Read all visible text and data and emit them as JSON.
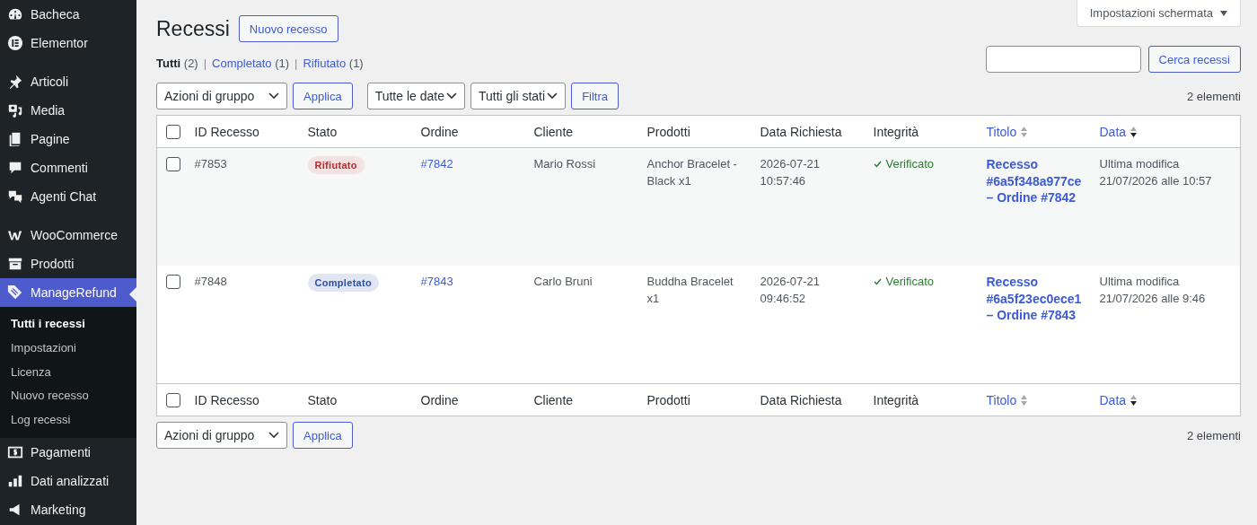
{
  "sidebar": {
    "groups": [
      {
        "items": [
          {
            "label": "Bacheca",
            "selected": false
          },
          {
            "label": "Elementor",
            "selected": false
          }
        ]
      },
      {
        "items": [
          {
            "label": "Articoli",
            "selected": false
          },
          {
            "label": "Media",
            "selected": false
          },
          {
            "label": "Pagine",
            "selected": false
          },
          {
            "label": "Commenti",
            "selected": false
          },
          {
            "label": "Agenti Chat",
            "selected": false
          }
        ]
      },
      {
        "items": [
          {
            "label": "WooCommerce",
            "selected": false
          },
          {
            "label": "Prodotti",
            "selected": false
          },
          {
            "label": "ManageRefund",
            "selected": true,
            "children": [
              {
                "label": "Tutti i recessi",
                "selected": true
              },
              {
                "label": "Impostazioni",
                "selected": false
              },
              {
                "label": "Licenza",
                "selected": false
              },
              {
                "label": "Nuovo recesso",
                "selected": false
              },
              {
                "label": "Log recessi",
                "selected": false
              }
            ]
          },
          {
            "label": "Pagamenti",
            "selected": false
          },
          {
            "label": "Dati analizzati",
            "selected": false
          },
          {
            "label": "Marketing",
            "selected": false
          }
        ]
      }
    ]
  },
  "screen_options": "Impostazioni schermata",
  "page_title": "Recessi",
  "add_new_button": "Nuovo recesso",
  "views": [
    {
      "label": "Tutti",
      "count": "(2)",
      "selected": true
    },
    {
      "separator_before": "|",
      "label": "Completato",
      "count": "(1)",
      "selected": false
    },
    {
      "separator_before": "|",
      "label": "Rifiutato",
      "count": "(1)",
      "selected": false
    }
  ],
  "search": {
    "button": "Cerca recessi"
  },
  "top_nav": {
    "bulk_action": "Azioni di gruppo",
    "apply": "Applica",
    "date_filter": "Tutte le date",
    "status_filter": "Tutti gli stati",
    "filter_button": "Filtra",
    "count": "2 elementi"
  },
  "table": {
    "columns": [
      {
        "label": "ID Recesso",
        "kind": "plain"
      },
      {
        "label": "Stato",
        "kind": "plain"
      },
      {
        "label": "Ordine",
        "kind": "plain"
      },
      {
        "label": "Cliente",
        "kind": "plain"
      },
      {
        "label": "Prodotti",
        "kind": "plain"
      },
      {
        "label": "Data Richiesta",
        "kind": "plain"
      },
      {
        "label": "Integrità",
        "kind": "plain"
      },
      {
        "label": "Titolo",
        "kind": "sortable",
        "sorted": false
      },
      {
        "label": "Data",
        "kind": "sortable",
        "sorted": true
      }
    ],
    "footer_columns": [
      {
        "label": "ID Recesso",
        "kind": "plain"
      },
      {
        "label": "Stato",
        "kind": "plain"
      },
      {
        "label": "Ordine",
        "kind": "plain"
      },
      {
        "label": "Cliente",
        "kind": "plain"
      },
      {
        "label": "Prodotti",
        "kind": "plain"
      },
      {
        "label": "Data Richiesta",
        "kind": "plain"
      },
      {
        "label": "Integrità",
        "kind": "plain"
      },
      {
        "label": "Titolo",
        "kind": "sortable",
        "sorted": false
      },
      {
        "label": "Data",
        "kind": "sortable",
        "sorted": true
      }
    ],
    "footer_select_all_checked": false,
    "rows": [
      {
        "checked": false,
        "id": "#7853",
        "status": "Rifiutato",
        "color": "#b32d2e",
        "order": "#7842",
        "customer": "Mario Rossi",
        "products": "Anchor Bracelet - Black x1",
        "requested": [
          "2026-07-21",
          "10:57:46"
        ],
        "integrity": "Verificato",
        "title": "Recesso #6a5f348a977ce – Ordine #7842",
        "date": [
          "Ultima modifica",
          "21/07/2026 alle 10:57"
        ]
      },
      {
        "checked": false,
        "id": "#7848",
        "status": "Completato",
        "color": "#2a4fa8",
        "order": "#7843",
        "customer": "Carlo Bruni",
        "products": "Buddha Bracelet x1",
        "requested": [
          "2026-07-21",
          "09:46:52"
        ],
        "integrity": "Verificato",
        "title": "Recesso #6a5f23ec0ece1 – Ordine #7843",
        "date": [
          "Ultima modifica",
          "21/07/2026 alle 9:46"
        ]
      }
    ],
    "select_all_checked": false
  },
  "bottom_nav": {
    "bulk_action": "Azioni di gruppo",
    "apply": "Applica",
    "count": "2 elementi"
  }
}
